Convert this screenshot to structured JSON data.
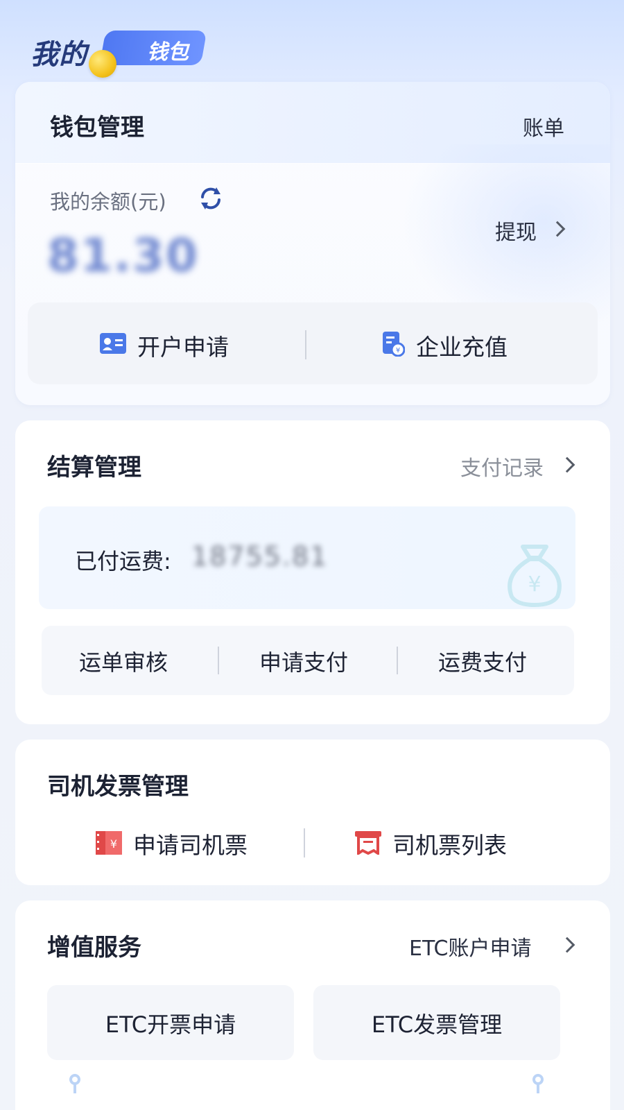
{
  "header": {
    "title": "我的",
    "badge": "钱包"
  },
  "wallet": {
    "title": "钱包管理",
    "bill_link": "账单",
    "balance_label": "我的余额(元)",
    "balance_value": "81.30",
    "withdraw_label": "提现",
    "actions": [
      {
        "label": "开户申请",
        "icon": "id-card-icon"
      },
      {
        "label": "企业充值",
        "icon": "recharge-icon"
      }
    ]
  },
  "settlement": {
    "title": "结算管理",
    "records_link": "支付记录",
    "paid_label": "已付运费:",
    "paid_value": "18755.81",
    "actions": [
      {
        "label": "运单审核"
      },
      {
        "label": "申请支付"
      },
      {
        "label": "运费支付"
      }
    ]
  },
  "driver_invoice": {
    "title": "司机发票管理",
    "actions": [
      {
        "label": "申请司机票",
        "icon": "yuan-ticket-icon"
      },
      {
        "label": "司机票列表",
        "icon": "invoice-list-icon"
      }
    ]
  },
  "value_added": {
    "title": "增值服务",
    "etc_link": "ETC账户申请",
    "buttons": [
      {
        "label": "ETC开票申请"
      },
      {
        "label": "ETC发票管理"
      }
    ]
  },
  "colors": {
    "header_text": "#253a7a",
    "badge_bg": "#5b82f5",
    "coin": "#f4c21c",
    "accent_blue": "#4a78e8",
    "invoice_red": "#e04848"
  }
}
